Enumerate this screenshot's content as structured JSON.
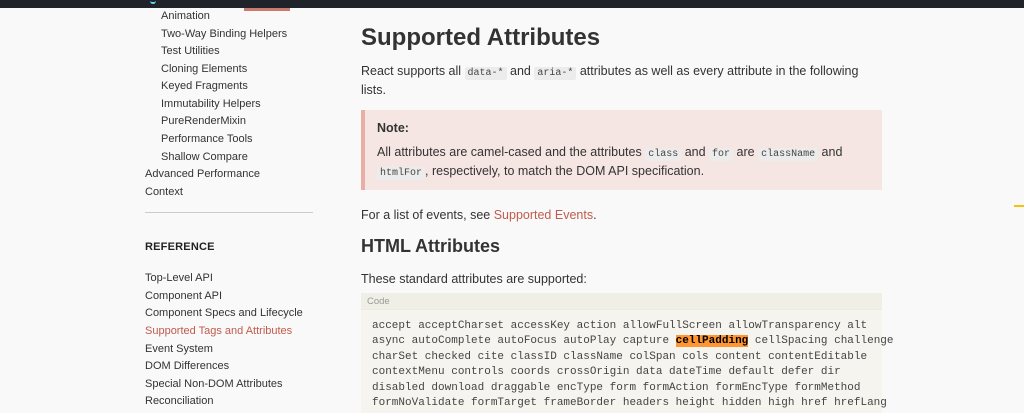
{
  "sidebar": {
    "sub_items": [
      "Animation",
      "Two-Way Binding Helpers",
      "Test Utilities",
      "Cloning Elements",
      "Keyed Fragments",
      "Immutability Helpers",
      "PureRenderMixin",
      "Performance Tools",
      "Shallow Compare"
    ],
    "top_items": [
      "Advanced Performance",
      "Context"
    ],
    "reference_title": "REFERENCE",
    "reference_items": [
      "Top-Level API",
      "Component API",
      "Component Specs and Lifecycle",
      "Supported Tags and Attributes",
      "Event System",
      "DOM Differences",
      "Special Non-DOM Attributes",
      "Reconciliation"
    ],
    "active_item": "Supported Tags and Attributes"
  },
  "main": {
    "title": "Supported Attributes",
    "intro": {
      "prefix": "React supports all ",
      "code1": "data-*",
      "and": " and ",
      "code2": "aria-*",
      "suffix": " attributes as well as every attribute in the following lists."
    },
    "note": {
      "title": "Note:",
      "t1": "All attributes are camel-cased and the attributes ",
      "c1": "class",
      "t2": " and ",
      "c2": "for",
      "t3": " are ",
      "c3": "className",
      "t4": " and ",
      "c4": "htmlFor",
      "t5": ", respectively, to match the DOM API specification."
    },
    "events_line": {
      "prefix": "For a list of events, see ",
      "link": "Supported Events",
      "suffix": "."
    },
    "html_heading": "HTML Attributes",
    "html_intro": "These standard attributes are supported:",
    "code_label": "Code",
    "code_lines": {
      "l1": "accept acceptCharset accessKey action allowFullScreen allowTransparency alt",
      "l2_before": "async autoComplete autoFocus autoPlay capture ",
      "l2_highlight": "cellPadding",
      "l2_after": " cellSpacing challenge",
      "l3": "charSet checked cite classID className colSpan cols content contentEditable",
      "l4": "contextMenu controls coords crossOrigin data dateTime default defer dir",
      "l5": "disabled download draggable encType form formAction formEncType formMethod",
      "l6": "formNoValidate formTarget frameBorder headers height hidden high href hrefLang"
    }
  }
}
